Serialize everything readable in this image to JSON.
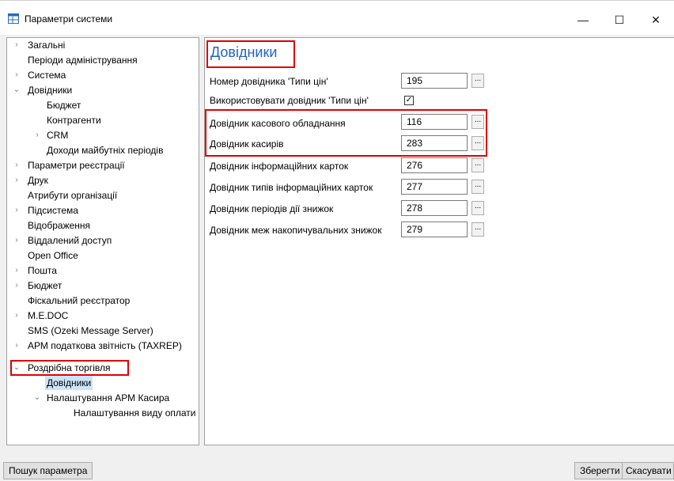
{
  "window": {
    "title": "Параметри системи",
    "controls": {
      "minimize": "—",
      "maximize": "☐",
      "close": "✕"
    }
  },
  "tree": {
    "items": [
      {
        "label": "Загальні",
        "expander": "›"
      },
      {
        "label": "Періоди адміністрування",
        "expander": ""
      },
      {
        "label": "Система",
        "expander": "›"
      },
      {
        "label": "Довідники",
        "expander": "⌄"
      },
      {
        "label": "Бюджет",
        "expander": ""
      },
      {
        "label": "Контрагенти",
        "expander": ""
      },
      {
        "label": "CRM",
        "expander": "›"
      },
      {
        "label": "Доходи майбутніх періодів",
        "expander": ""
      },
      {
        "label": "Параметри реєстрації",
        "expander": "›"
      },
      {
        "label": "Друк",
        "expander": "›"
      },
      {
        "label": "Атрибути організації",
        "expander": ""
      },
      {
        "label": "Підсистема",
        "expander": "›"
      },
      {
        "label": "Відображення",
        "expander": ""
      },
      {
        "label": "Віддалений доступ",
        "expander": "›"
      },
      {
        "label": "Open Office",
        "expander": ""
      },
      {
        "label": "Пошта",
        "expander": "›"
      },
      {
        "label": "Бюджет",
        "expander": "›"
      },
      {
        "label": "Фіскальний реєстратор",
        "expander": ""
      },
      {
        "label": "M.E.DOC",
        "expander": "›"
      },
      {
        "label": "SMS (Ozeki Message Server)",
        "expander": ""
      },
      {
        "label": "АРМ податкова звітність (TAXREP)",
        "expander": "›"
      },
      {
        "label": "Роздрібна торгівля",
        "expander": "⌄"
      },
      {
        "label": "Довідники",
        "expander": ""
      },
      {
        "label": "Налаштування АРМ Касира",
        "expander": "⌄"
      },
      {
        "label": "Налаштування виду оплати",
        "expander": ""
      }
    ]
  },
  "panel": {
    "heading": "Довідники",
    "rows": [
      {
        "label": "Номер довідника 'Типи цін'",
        "value": "195",
        "browse": "..."
      },
      {
        "label": "Використовувати довідник 'Типи цін'",
        "checkbox": "✓"
      },
      {
        "label": "Довідник касового обладнання",
        "value": "116",
        "browse": "..."
      },
      {
        "label": "Довідник касирів",
        "value": "283",
        "browse": "..."
      },
      {
        "label": "Довідник інформаційних карток",
        "value": "276",
        "browse": "..."
      },
      {
        "label": "Довідник типів інформаційних карток",
        "value": "277",
        "browse": "..."
      },
      {
        "label": "Довідник періодів дії знижок",
        "value": "278",
        "browse": "..."
      },
      {
        "label": "Довідник меж накопичувальних знижок",
        "value": "279",
        "browse": "..."
      }
    ]
  },
  "buttons": {
    "search": "Пошук параметра",
    "save": "Зберегти",
    "cancel": "Скасувати"
  },
  "colors": {
    "heading": "#1e64c8",
    "highlight": "#e00000",
    "selection": "#cce4f7"
  }
}
